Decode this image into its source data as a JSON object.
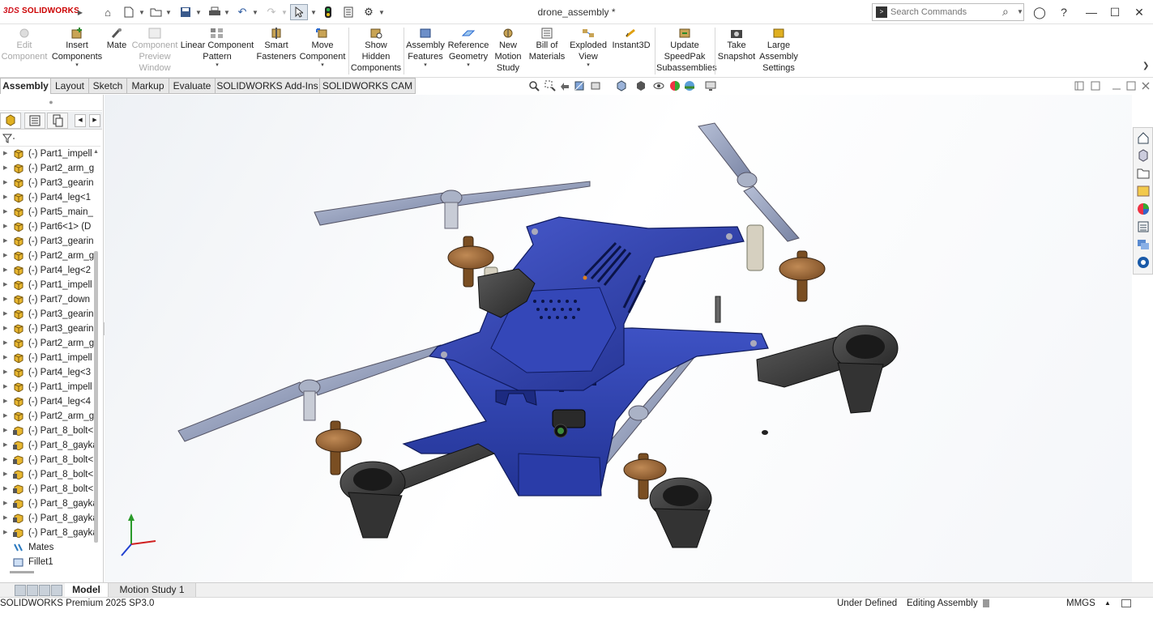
{
  "app": {
    "logo_prefix": "3DS",
    "logo_name": "SOLIDWORKS",
    "doc_title": "drone_assembly *"
  },
  "search": {
    "placeholder": "Search Commands"
  },
  "ribbon": [
    {
      "label": "Edit",
      "label2": "Component",
      "icon": "edit-component-icon",
      "disabled": true
    },
    {
      "label": "Insert",
      "label2": "Components",
      "icon": "insert-components-icon",
      "has_menu": true
    },
    {
      "label": "Mate",
      "icon": "mate-icon"
    },
    {
      "label": "Component",
      "label2": "Preview",
      "label3": "Window",
      "icon": "component-preview-icon",
      "disabled": true
    },
    {
      "label": "Linear Component",
      "label2": "Pattern",
      "icon": "linear-pattern-icon",
      "has_menu": true
    },
    {
      "label": "Smart",
      "label2": "Fasteners",
      "icon": "smart-fasteners-icon"
    },
    {
      "label": "Move",
      "label2": "Component",
      "icon": "move-component-icon",
      "has_menu": true
    },
    {
      "label": "Show",
      "label2": "Hidden",
      "label3": "Components",
      "icon": "show-hidden-icon"
    },
    {
      "label": "Assembly",
      "label2": "Features",
      "icon": "assembly-features-icon",
      "has_menu": true
    },
    {
      "label": "Reference",
      "label2": "Geometry",
      "icon": "reference-geometry-icon",
      "has_menu": true
    },
    {
      "label": "New",
      "label2": "Motion",
      "label3": "Study",
      "icon": "motion-study-icon"
    },
    {
      "label": "Bill of",
      "label2": "Materials",
      "icon": "bom-icon"
    },
    {
      "label": "Exploded",
      "label2": "View",
      "icon": "exploded-view-icon",
      "has_menu": true
    },
    {
      "label": "Instant3D",
      "icon": "instant3d-icon"
    },
    {
      "label": "Update",
      "label2": "SpeedPak",
      "label3": "Subassemblies",
      "icon": "speedpak-icon"
    },
    {
      "label": "Take",
      "label2": "Snapshot",
      "icon": "snapshot-icon"
    },
    {
      "label": "Large",
      "label2": "Assembly",
      "label3": "Settings",
      "icon": "large-assembly-icon"
    }
  ],
  "tabs": [
    "Assembly",
    "Layout",
    "Sketch",
    "Markup",
    "Evaluate",
    "SOLIDWORKS Add-Ins",
    "SOLIDWORKS CAM"
  ],
  "active_tab": "Assembly",
  "tree": [
    {
      "label": "(-) Part1_impell",
      "kind": "part"
    },
    {
      "label": "(-) Part2_arm_g",
      "kind": "part"
    },
    {
      "label": "(-) Part3_gearin",
      "kind": "part"
    },
    {
      "label": "(-) Part4_leg<1",
      "kind": "part"
    },
    {
      "label": "(-) Part5_main_",
      "kind": "part"
    },
    {
      "label": "(-) Part6<1> (D",
      "kind": "part"
    },
    {
      "label": "(-) Part3_gearin",
      "kind": "part"
    },
    {
      "label": "(-) Part2_arm_g",
      "kind": "part"
    },
    {
      "label": "(-) Part4_leg<2",
      "kind": "part"
    },
    {
      "label": "(-) Part1_impell",
      "kind": "part"
    },
    {
      "label": "(-) Part7_down",
      "kind": "part"
    },
    {
      "label": "(-) Part3_gearin",
      "kind": "part"
    },
    {
      "label": "(-) Part3_gearin",
      "kind": "part"
    },
    {
      "label": "(-) Part2_arm_g",
      "kind": "part"
    },
    {
      "label": "(-) Part1_impell",
      "kind": "part"
    },
    {
      "label": "(-) Part4_leg<3",
      "kind": "part"
    },
    {
      "label": "(-) Part1_impell",
      "kind": "part"
    },
    {
      "label": "(-) Part4_leg<4",
      "kind": "part"
    },
    {
      "label": "(-) Part2_arm_g",
      "kind": "part"
    },
    {
      "label": "(-) Part_8_bolt<",
      "kind": "toolbox"
    },
    {
      "label": "(-) Part_8_gayka",
      "kind": "toolbox"
    },
    {
      "label": "(-) Part_8_bolt<",
      "kind": "toolbox"
    },
    {
      "label": "(-) Part_8_bolt<",
      "kind": "toolbox"
    },
    {
      "label": "(-) Part_8_bolt<",
      "kind": "toolbox"
    },
    {
      "label": "(-) Part_8_gayka",
      "kind": "toolbox"
    },
    {
      "label": "(-) Part_8_gayka",
      "kind": "toolbox"
    },
    {
      "label": "(-) Part_8_gayka",
      "kind": "toolbox"
    },
    {
      "label": "Mates",
      "kind": "mates"
    },
    {
      "label": "Fillet1",
      "kind": "feature"
    }
  ],
  "bottom_tabs": [
    "Model",
    "Motion Study 1"
  ],
  "status": {
    "product": "SOLIDWORKS Premium 2025 SP3.0",
    "state": "Under Defined",
    "mode": "Editing Assembly",
    "units": "MMGS"
  },
  "colors": {
    "body_blue": "#3346b4",
    "arm_dark": "#3d3d3d",
    "propeller": "#8f9bb8",
    "gear_brown": "#9a6a3b",
    "accent_red": "#d0101b"
  }
}
